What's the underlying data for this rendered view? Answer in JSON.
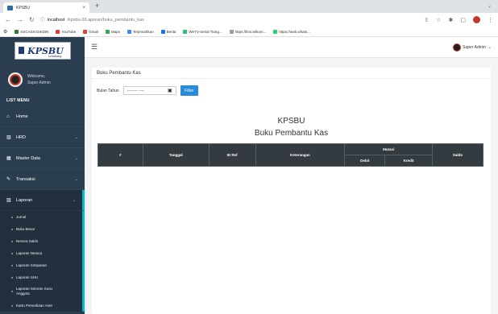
{
  "browser": {
    "tab_title": "KPSBU",
    "tab_close": "×",
    "new_tab": "+",
    "url_host": "localhost",
    "url_path": "/kpsbu-2/Laporan/buku_pembantu_kas",
    "bookmarks": [
      {
        "label": "SSCASN DIKDIN",
        "color": "#2e7d32"
      },
      {
        "label": "YouTube",
        "color": "#e53935"
      },
      {
        "label": "Gmail",
        "color": "#d44638"
      },
      {
        "label": "Maps",
        "color": "#34a853"
      },
      {
        "label": "Terjemahkan",
        "color": "#4285f4"
      },
      {
        "label": "Berita",
        "color": "#1a73e8"
      },
      {
        "label": "WeTV-Serial Tiong...",
        "color": "#2fbf71"
      },
      {
        "label": "https://lms.telkom...",
        "color": "#9e9e9e"
      },
      {
        "label": "https://web.whats...",
        "color": "#25d366"
      }
    ]
  },
  "sidebar": {
    "logo_text": "KPSBU",
    "logo_sub": "Lembang",
    "welcome": "Welcome,",
    "role": "Super Admin",
    "menu_header": "LIST MENU",
    "items": [
      {
        "label": "Home",
        "icon": "home-icon",
        "glyph": "⌂"
      },
      {
        "label": "HRD",
        "icon": "chart-icon",
        "glyph": "▥",
        "chev": "⌄"
      },
      {
        "label": "Master Data",
        "icon": "table-icon",
        "glyph": "▦",
        "chev": "⌄"
      },
      {
        "label": "Transaksi",
        "icon": "edit-icon",
        "glyph": "✎",
        "chev": "⌄"
      },
      {
        "label": "Laporan",
        "icon": "chart-icon",
        "glyph": "▥",
        "chev": "⌄"
      }
    ],
    "sub_items": [
      "Jurnal",
      "Buku Besar",
      "Neraca Saldo",
      "Laporan Neraca",
      "Laporan Simpanan",
      "Laporan SHU",
      "Laporan Setoran Susu Anggota",
      "Kartu Persediaan Aset"
    ]
  },
  "topbar": {
    "user": "Super Admin"
  },
  "page": {
    "card_title": "Buku Pembantu Kas",
    "filter_label": "Bulan Tahun",
    "month_placeholder": "-------- ----",
    "filter_button": "Filter",
    "title_line1": "KPSBU",
    "title_line2": "Buku Pembantu Kas"
  },
  "table": {
    "col_no": "#",
    "col_tanggal": "Tanggal",
    "col_idref": "ID Ref",
    "col_keterangan": "Keterangan",
    "group_mutasi": "Mutasi",
    "col_debit": "Debit",
    "col_kredit": "Kredit",
    "col_saldo": "Saldo"
  }
}
